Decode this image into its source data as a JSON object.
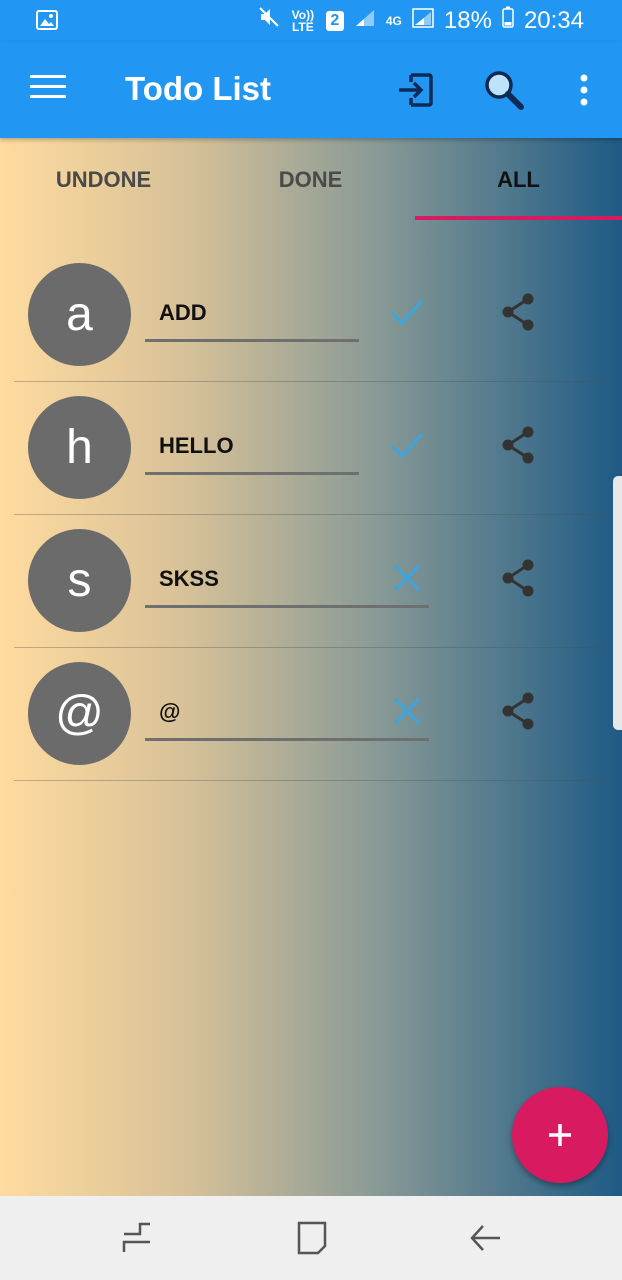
{
  "status_bar": {
    "volte": "Vo)) LTE",
    "sim_slot": "2",
    "network": "4G",
    "battery": "18%",
    "time": "20:34"
  },
  "app_bar": {
    "title": "Todo List",
    "icons": [
      "menu-icon",
      "exit-icon",
      "search-icon",
      "more-vert-icon"
    ]
  },
  "tabs": [
    {
      "label": "UNDONE",
      "active": false
    },
    {
      "label": "DONE",
      "active": false
    },
    {
      "label": "ALL",
      "active": true
    }
  ],
  "todos": [
    {
      "avatar": "a",
      "text": "ADD",
      "status": "done",
      "status_icon": "check-icon"
    },
    {
      "avatar": "h",
      "text": "HELLO",
      "status": "done",
      "status_icon": "check-icon"
    },
    {
      "avatar": "s",
      "text": "SKSS",
      "status": "undone",
      "status_icon": "close-icon"
    },
    {
      "avatar": "@",
      "text": "@",
      "status": "undone",
      "status_icon": "close-icon"
    }
  ],
  "fab": {
    "icon": "plus-icon"
  },
  "colors": {
    "primary": "#2196f3",
    "accent": "#d81b60",
    "status_icon": "#3aa6e0",
    "avatar": "#6b6b6b"
  },
  "nav_bar": {
    "icons": [
      "recent-apps-icon",
      "home-icon",
      "back-icon"
    ]
  }
}
